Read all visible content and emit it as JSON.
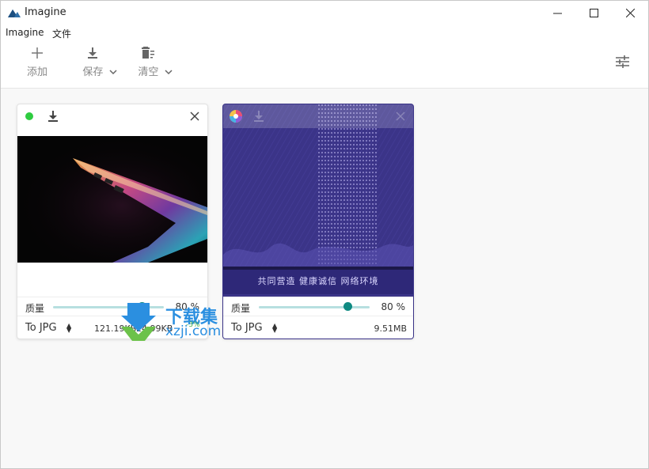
{
  "window": {
    "title": "Imagine"
  },
  "menu": {
    "items": [
      "Imagine",
      "文件"
    ]
  },
  "toolbar": {
    "add_label": "添加",
    "save_label": "保存",
    "clear_label": "清空"
  },
  "cards": [
    {
      "quality_label": "质量",
      "quality_value_text": "80",
      "quality_unit": "%",
      "quality": 0.8,
      "format": "To JPG",
      "original_size": "121.19KB",
      "new_size": "24.99KB",
      "savings": "-3%"
    },
    {
      "quality_label": "质量",
      "quality_value_text": "80",
      "quality_unit": "%",
      "quality": 0.8,
      "format": "To JPG",
      "size": "9.51MB",
      "banner_text": "共同营造 健康诚信 网络环境"
    }
  ],
  "watermark": {
    "cn": "下载集",
    "site": "xzji.com"
  },
  "colors": {
    "accent": "#0f8a82",
    "slider_track": "#b7dfe0",
    "status_green": "#2ecc40",
    "card2_bg": "#3b3488"
  }
}
